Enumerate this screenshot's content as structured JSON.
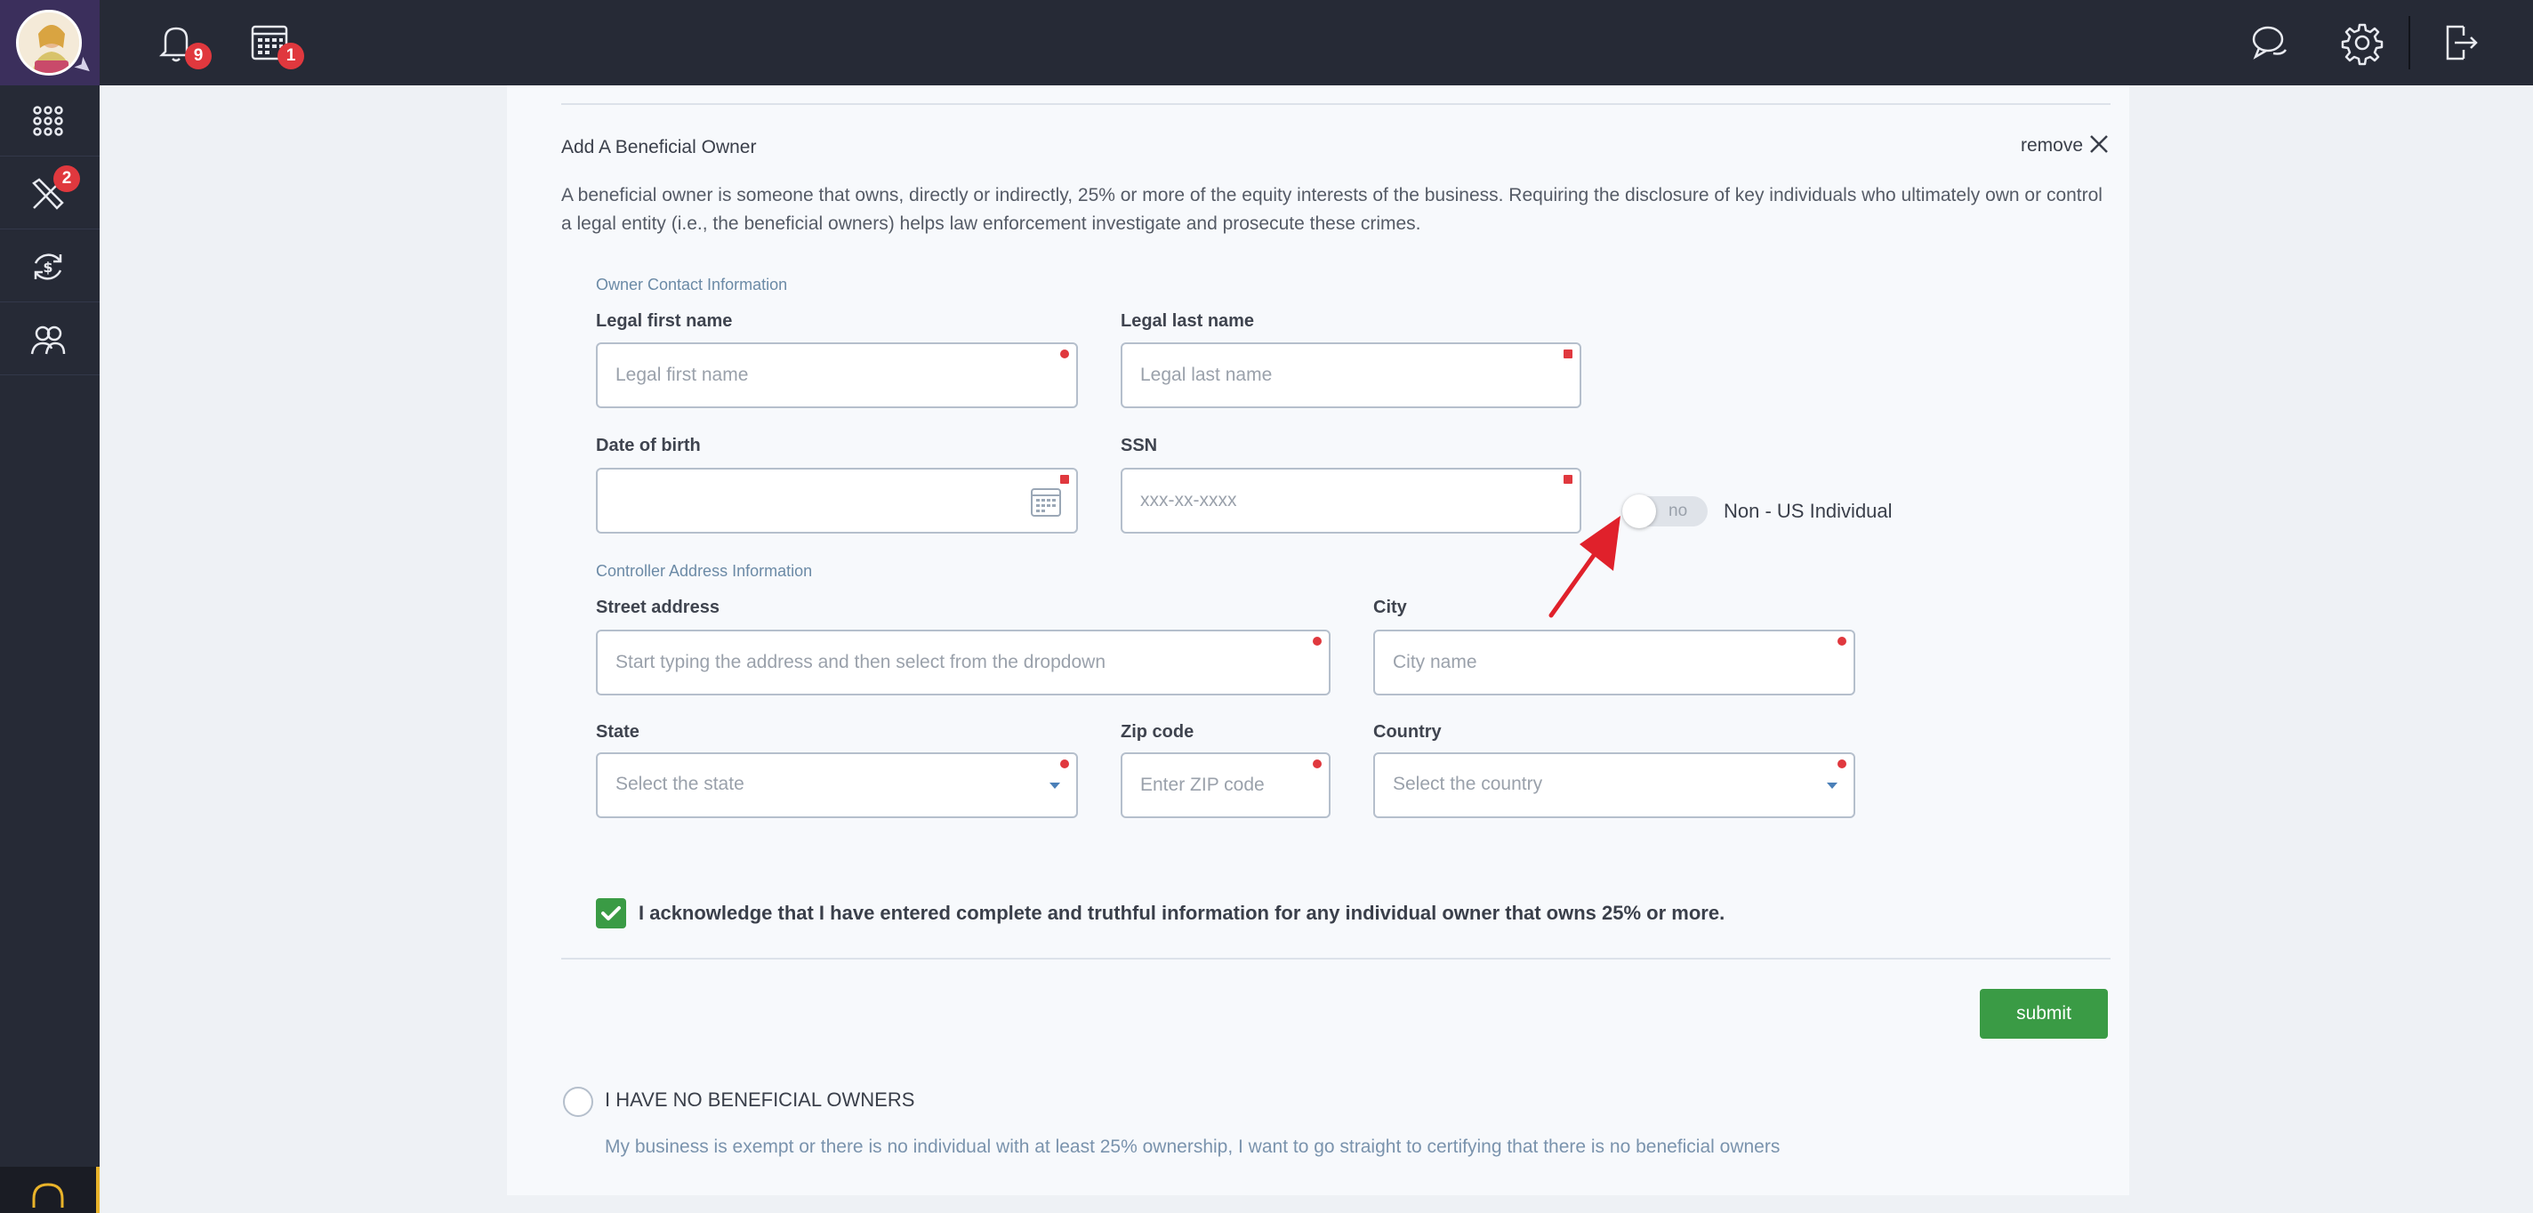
{
  "topbar": {
    "notifications_count": "9",
    "calendar_count": "1"
  },
  "sidebar": {
    "tools_badge": "2"
  },
  "section": {
    "title": "Add A Beneficial Owner",
    "remove_label": "remove",
    "description": "A beneficial owner is someone that owns, directly or indirectly, 25% or more of the equity interests of the business. Requiring the disclosure of key individuals who ultimately own or control a legal entity (i.e., the beneficial owners) helps law enforcement investigate and prosecute these crimes."
  },
  "contact": {
    "heading": "Owner Contact Information",
    "first_name": {
      "label": "Legal first name",
      "placeholder": "Legal first name"
    },
    "last_name": {
      "label": "Legal last name",
      "placeholder": "Legal last name"
    },
    "dob": {
      "label": "Date of birth",
      "placeholder": ""
    },
    "ssn": {
      "label": "SSN",
      "placeholder": "xxx-xx-xxxx"
    },
    "non_us": {
      "toggle_value": "no",
      "label": "Non - US Individual"
    }
  },
  "address": {
    "heading": "Controller Address Information",
    "street": {
      "label": "Street address",
      "placeholder": "Start typing the address and then select from the dropdown"
    },
    "city": {
      "label": "City",
      "placeholder": "City name"
    },
    "state": {
      "label": "State",
      "placeholder": "Select the state"
    },
    "zip": {
      "label": "Zip code",
      "placeholder": "Enter ZIP code"
    },
    "country": {
      "label": "Country",
      "placeholder": "Select the country"
    }
  },
  "acknowledge": {
    "checked": true,
    "text": "I acknowledge that I have entered complete and truthful information for any individual owner that owns 25% or more."
  },
  "submit_label": "submit",
  "no_owners": {
    "label": "I HAVE NO BENEFICIAL OWNERS",
    "description": "My business is exempt or there is no individual with at least 25% ownership, I want to go straight to certifying that there is no beneficial owners"
  },
  "colors": {
    "topbar": "#262a36",
    "accent_green": "#3a9b45",
    "badge_red": "#e0383e",
    "annotation_arrow": "#e0212b"
  },
  "icons": [
    "bell-icon",
    "calendar-icon",
    "chat-icon",
    "gear-icon",
    "logout-icon",
    "apps-grid-icon",
    "tools-icon",
    "exchange-dollar-icon",
    "users-icon",
    "headset-icon",
    "calendar-picker-icon",
    "close-icon",
    "check-icon",
    "pin-icon"
  ]
}
